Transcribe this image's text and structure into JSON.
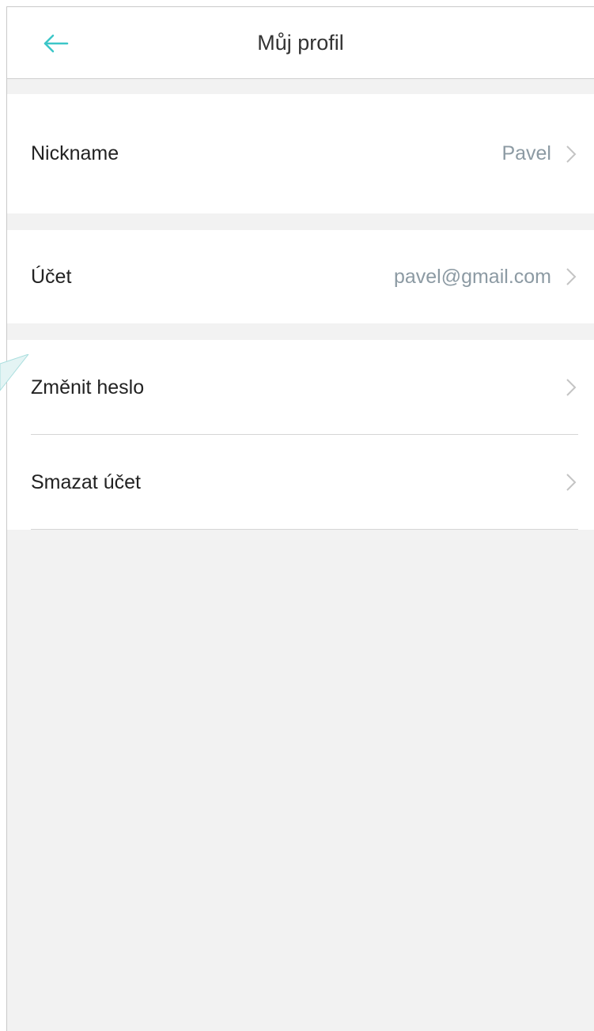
{
  "header": {
    "title": "Můj profil",
    "back_icon": "arrow-left-icon",
    "accent_color": "#3cc6c8"
  },
  "profile": {
    "nickname": {
      "label": "Nickname",
      "value": "Pavel"
    },
    "account": {
      "label": "Účet",
      "value": "pavel@gmail.com"
    },
    "change_password": {
      "label": "Změnit heslo"
    },
    "delete_account": {
      "label": "Smazat účet"
    }
  },
  "icons": {
    "chevron": "chevron-right-icon"
  },
  "colors": {
    "background": "#f2f2f2",
    "row_background": "#ffffff",
    "value_text": "#8c9aa3"
  }
}
